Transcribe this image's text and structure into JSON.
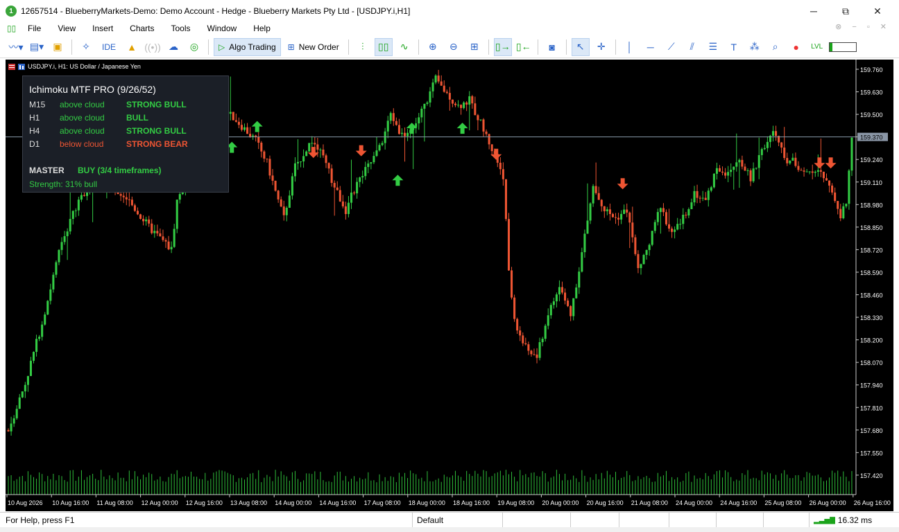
{
  "window": {
    "title": "12657514 - BlueberryMarkets-Demo: Demo Account - Hedge - Blueberry Markets Pty Ltd - [USDJPY.i,H1]",
    "app_badge": "1",
    "minimize": "─",
    "restore": "⧉",
    "close": "✕"
  },
  "menu": {
    "items": [
      "File",
      "View",
      "Insert",
      "Charts",
      "Tools",
      "Window",
      "Help"
    ],
    "mdi_controls": "⊗ − ▫ ✕"
  },
  "toolbar": {
    "ide_label": "IDE",
    "algo_trading_label": "Algo Trading",
    "new_order_label": "New Order"
  },
  "chart": {
    "symbol_line": "USDJPY.i, H1:  US Dollar / Japanese Yen",
    "current_price": "159.370",
    "background": "#000000",
    "bull_color": "#33cc44",
    "bear_color": "#ee5533",
    "price_line_color": "#8899aa"
  },
  "indicator_panel": {
    "title": "Ichimoku MTF PRO (9/26/52)",
    "rows": [
      {
        "tf": "M15",
        "position": "above cloud",
        "signal": "STRONG BULL",
        "bias": "bull"
      },
      {
        "tf": "H1",
        "position": "above cloud",
        "signal": "BULL",
        "bias": "bull"
      },
      {
        "tf": "H4",
        "position": "above cloud",
        "signal": "STRONG BULL",
        "bias": "bull"
      },
      {
        "tf": "D1",
        "position": "below cloud",
        "signal": "STRONG BEAR",
        "bias": "bear"
      }
    ],
    "master_label": "MASTER",
    "master_signal": "BUY  (3/4 timeframes)",
    "strength": "Strength: 31% bull"
  },
  "chart_data": {
    "type": "candlestick",
    "price_axis_ticks": [
      "159.760",
      "159.630",
      "159.500",
      "159.370",
      "159.240",
      "159.110",
      "158.980",
      "158.850",
      "158.720",
      "158.590",
      "158.460",
      "158.330",
      "158.200",
      "158.070",
      "157.940",
      "157.810",
      "157.680",
      "157.550",
      "157.420"
    ],
    "time_axis_labels": [
      "10 Aug 2026",
      "10 Aug 16:00",
      "11 Aug 08:00",
      "12 Aug 00:00",
      "12 Aug 16:00",
      "13 Aug 08:00",
      "14 Aug 00:00",
      "14 Aug 16:00",
      "17 Aug 08:00",
      "18 Aug 00:00",
      "18 Aug 16:00",
      "19 Aug 08:00",
      "20 Aug 00:00",
      "20 Aug 16:00",
      "21 Aug 08:00",
      "24 Aug 00:00",
      "24 Aug 16:00",
      "25 Aug 08:00",
      "26 Aug 00:00",
      "26 Aug 16:00"
    ],
    "ylim": [
      157.33,
      159.8
    ],
    "close_path": [
      [
        0,
        157.68
      ],
      [
        6,
        157.95
      ],
      [
        12,
        158.3
      ],
      [
        18,
        158.7
      ],
      [
        22,
        158.9
      ],
      [
        28,
        159.08
      ],
      [
        34,
        159.1
      ],
      [
        42,
        159.02
      ],
      [
        50,
        158.85
      ],
      [
        58,
        158.72
      ],
      [
        60,
        159.0
      ],
      [
        64,
        159.2
      ],
      [
        68,
        159.3
      ],
      [
        70,
        159.38
      ],
      [
        74,
        159.46
      ],
      [
        78,
        159.52
      ],
      [
        82,
        159.45
      ],
      [
        88,
        159.35
      ],
      [
        92,
        159.22
      ],
      [
        96,
        159.0
      ],
      [
        98,
        158.9
      ],
      [
        102,
        159.2
      ],
      [
        108,
        159.35
      ],
      [
        112,
        159.25
      ],
      [
        116,
        159.08
      ],
      [
        120,
        158.95
      ],
      [
        124,
        159.1
      ],
      [
        128,
        159.2
      ],
      [
        132,
        159.3
      ],
      [
        136,
        159.5
      ],
      [
        140,
        159.38
      ],
      [
        144,
        159.42
      ],
      [
        148,
        159.55
      ],
      [
        152,
        159.7
      ],
      [
        156,
        159.62
      ],
      [
        160,
        159.55
      ],
      [
        164,
        159.58
      ],
      [
        168,
        159.45
      ],
      [
        172,
        159.3
      ],
      [
        176,
        159.15
      ],
      [
        178,
        158.6
      ],
      [
        180,
        158.3
      ],
      [
        184,
        158.15
      ],
      [
        188,
        158.1
      ],
      [
        192,
        158.35
      ],
      [
        196,
        158.5
      ],
      [
        200,
        158.35
      ],
      [
        204,
        158.7
      ],
      [
        208,
        159.08
      ],
      [
        212,
        158.95
      ],
      [
        216,
        158.9
      ],
      [
        220,
        158.95
      ],
      [
        224,
        158.6
      ],
      [
        228,
        158.75
      ],
      [
        232,
        158.98
      ],
      [
        236,
        158.8
      ],
      [
        240,
        158.9
      ],
      [
        244,
        159.05
      ],
      [
        248,
        159.0
      ],
      [
        252,
        159.2
      ],
      [
        256,
        159.15
      ],
      [
        260,
        159.25
      ],
      [
        264,
        159.12
      ],
      [
        268,
        159.3
      ],
      [
        272,
        159.4
      ],
      [
        276,
        159.25
      ],
      [
        280,
        159.22
      ],
      [
        284,
        159.15
      ],
      [
        288,
        159.2
      ],
      [
        292,
        159.1
      ],
      [
        294,
        158.98
      ],
      [
        296,
        158.92
      ],
      [
        298,
        159.0
      ],
      [
        300,
        159.35
      ]
    ],
    "candle_count": 301,
    "volume_enabled": true
  },
  "signal_arrows": [
    {
      "dir": "up",
      "candle": 80,
      "price": 159.31
    },
    {
      "dir": "up",
      "candle": 89,
      "price": 159.43
    },
    {
      "dir": "down",
      "candle": 109,
      "price": 159.28
    },
    {
      "dir": "down",
      "candle": 126,
      "price": 159.29
    },
    {
      "dir": "up",
      "candle": 139,
      "price": 159.12
    },
    {
      "dir": "up",
      "candle": 144,
      "price": 159.42
    },
    {
      "dir": "up",
      "candle": 162,
      "price": 159.42
    },
    {
      "dir": "down",
      "candle": 174,
      "price": 159.27
    },
    {
      "dir": "down",
      "candle": 219,
      "price": 159.1
    },
    {
      "dir": "down",
      "candle": 289,
      "price": 159.22
    },
    {
      "dir": "down",
      "candle": 293,
      "price": 159.22
    }
  ],
  "status": {
    "help": "For Help, press F1",
    "profile": "Default",
    "ping": "16.32 ms"
  }
}
